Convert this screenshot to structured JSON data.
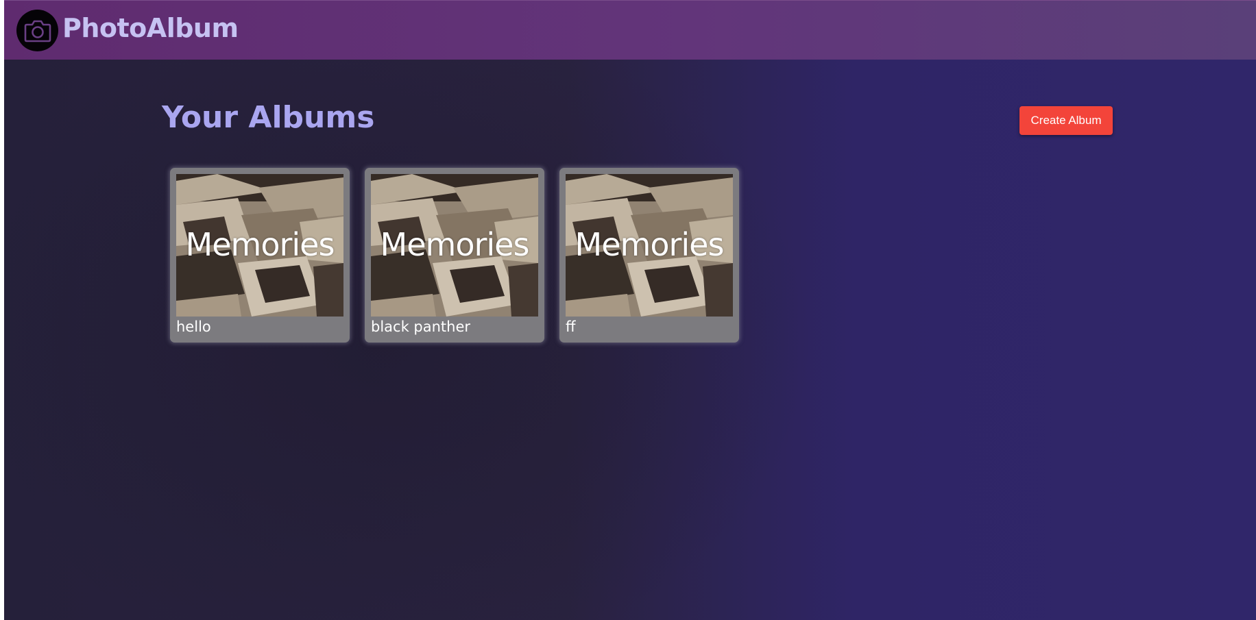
{
  "app": {
    "brand": "PhotoAlbum",
    "logo_icon": "camera-icon"
  },
  "main": {
    "title": "Your Albums",
    "create_button_label": "Create Album"
  },
  "albums": [
    {
      "cover_text": "Memories",
      "name": "hello"
    },
    {
      "cover_text": "Memories",
      "name": "black panther"
    },
    {
      "cover_text": "Memories",
      "name": "ff"
    }
  ],
  "colors": {
    "navbar_gradient": [
      "#5f2b6f",
      "#5a4079"
    ],
    "brand_text": "#c6c2f2",
    "title_text": "#aaa6f0",
    "create_button": "#f3443a",
    "card_background": "#7c7b7f"
  }
}
